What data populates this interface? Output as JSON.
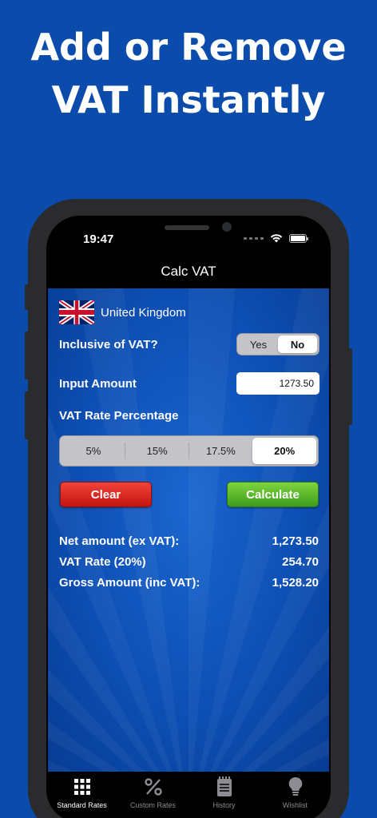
{
  "headline": {
    "line1": "Add or Remove",
    "line2": "VAT Instantly"
  },
  "status_bar": {
    "time": "19:47"
  },
  "nav": {
    "title": "Calc VAT"
  },
  "country": {
    "name": "United Kingdom",
    "flag": "uk-flag-icon"
  },
  "inclusive": {
    "label": "Inclusive of VAT?",
    "options": [
      "Yes",
      "No"
    ],
    "selected": "No"
  },
  "input": {
    "label": "Input Amount",
    "value": "1273.50"
  },
  "vat_rate": {
    "label": "VAT Rate Percentage",
    "options": [
      "5%",
      "15%",
      "17.5%",
      "20%"
    ],
    "selected": "20%"
  },
  "buttons": {
    "clear": "Clear",
    "calculate": "Calculate"
  },
  "results": [
    {
      "label": "Net amount (ex VAT):",
      "value": "1,273.50"
    },
    {
      "label": "VAT Rate (20%)",
      "value": "254.70"
    },
    {
      "label": "Gross Amount (inc VAT):",
      "value": "1,528.20"
    }
  ],
  "tabs": [
    {
      "label": "Standard Rates",
      "icon": "grid-icon",
      "active": true
    },
    {
      "label": "Custom Rates",
      "icon": "percent-icon",
      "active": false
    },
    {
      "label": "History",
      "icon": "notepad-icon",
      "active": false
    },
    {
      "label": "Wishlist",
      "icon": "lightbulb-icon",
      "active": false
    }
  ],
  "colors": {
    "background": "#0a4bab",
    "clear_button": "#d9241c",
    "calculate_button": "#5cb82c"
  }
}
